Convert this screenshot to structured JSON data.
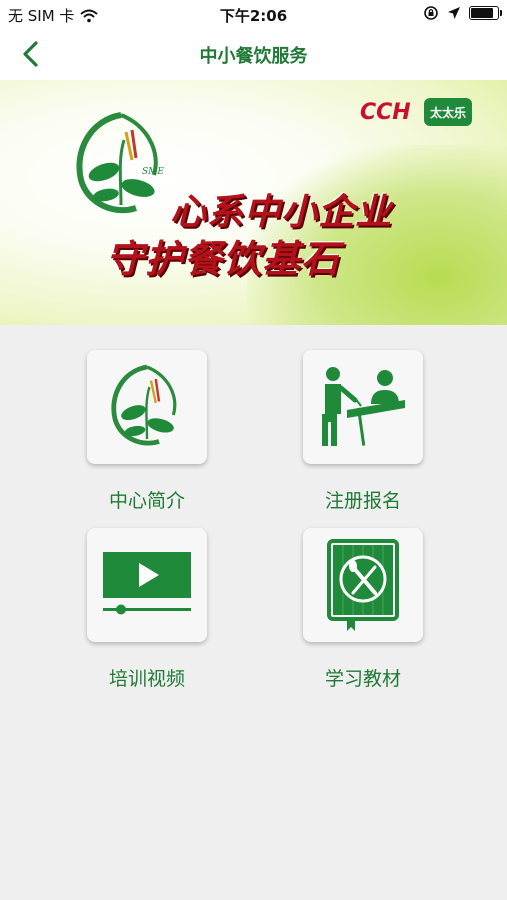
{
  "status_bar": {
    "carrier": "无 SIM 卡",
    "time": "下午2:06"
  },
  "nav": {
    "title": "中小餐饮服务"
  },
  "banner": {
    "slogan_line1": "心系中小企业",
    "slogan_line2": "守护餐饮基石",
    "logo_badge": "SME",
    "brand_cch": "CCH",
    "brand_taitai": "太太乐"
  },
  "menu": [
    {
      "label": "中心简介",
      "icon": "sme-leaf-logo-icon"
    },
    {
      "label": "注册报名",
      "icon": "registration-desk-icon"
    },
    {
      "label": "培训视频",
      "icon": "video-player-icon"
    },
    {
      "label": "学习教材",
      "icon": "cookbook-icon"
    }
  ],
  "colors": {
    "accent": "#1f7a35",
    "brand_red": "#b3121a"
  }
}
